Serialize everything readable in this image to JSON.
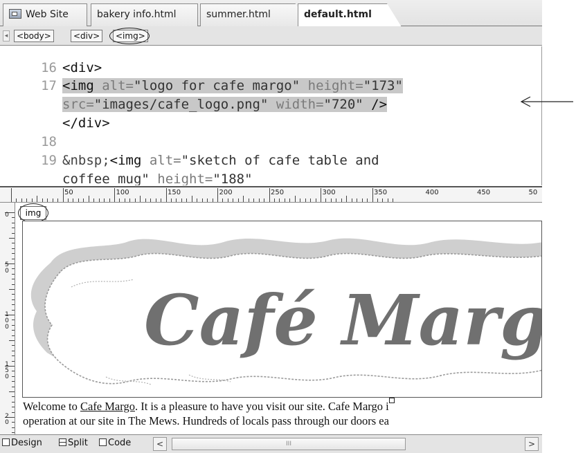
{
  "tabs": [
    {
      "label": "Web Site",
      "icon": "site-icon"
    },
    {
      "label": "bakery info.html"
    },
    {
      "label": "summer.html"
    },
    {
      "label": "default.html",
      "active": true
    }
  ],
  "tag_selector": [
    "<body>",
    "<div>",
    "<img>"
  ],
  "code": {
    "line_numbers": [
      "16",
      "17",
      "18",
      "19"
    ],
    "line16": "<div>",
    "line17a": {
      "open": "<img",
      "attr1": " alt=",
      "val1": "\"logo for cafe margo\"",
      "attr2": " height=",
      "val2": "\"173\""
    },
    "line17b": {
      "attr3": "src=",
      "val3": "\"images/cafe_logo.png\"",
      "attr4": " width=",
      "val4": "\"720\"",
      "close": " />"
    },
    "line17c": "</div>",
    "line19": {
      "prefix": "&nbsp;",
      "open": "<img",
      "attr1": " alt=",
      "val1": "\"sketch of cafe table and"
    },
    "line19b": {
      "val1cont": "coffee mug\"",
      "attr2": " height=",
      "val2": "\"188\""
    }
  },
  "ruler": {
    "marks": [
      "50",
      "100",
      "150",
      "200",
      "250",
      "300",
      "350",
      "400",
      "450",
      "50"
    ],
    "vertical_marks": [
      "0",
      "5\n0",
      "1\n0\n0",
      "1\n5\n0",
      "2\n0"
    ]
  },
  "design": {
    "img_tag": "img",
    "logo_text": "Café Marg",
    "welcome_line1_a": "Welcome to ",
    "welcome_link": "Cafe Margo",
    "welcome_line1_b": ". It is a pleasure to have you visit our site. Cafe Margo i",
    "welcome_line2": "operation at our site in The Mews. Hundreds of locals pass through our doors ea"
  },
  "bottom_bar": {
    "design": "Design",
    "split": "Split",
    "code": "Code",
    "scroll_left": "<",
    "scroll_right": ">",
    "scroll_thumb": "III"
  },
  "colors": {
    "logo_text": "#707070",
    "logo_shadow": "#c8c8c8",
    "highlight": "#c8c8c8"
  }
}
